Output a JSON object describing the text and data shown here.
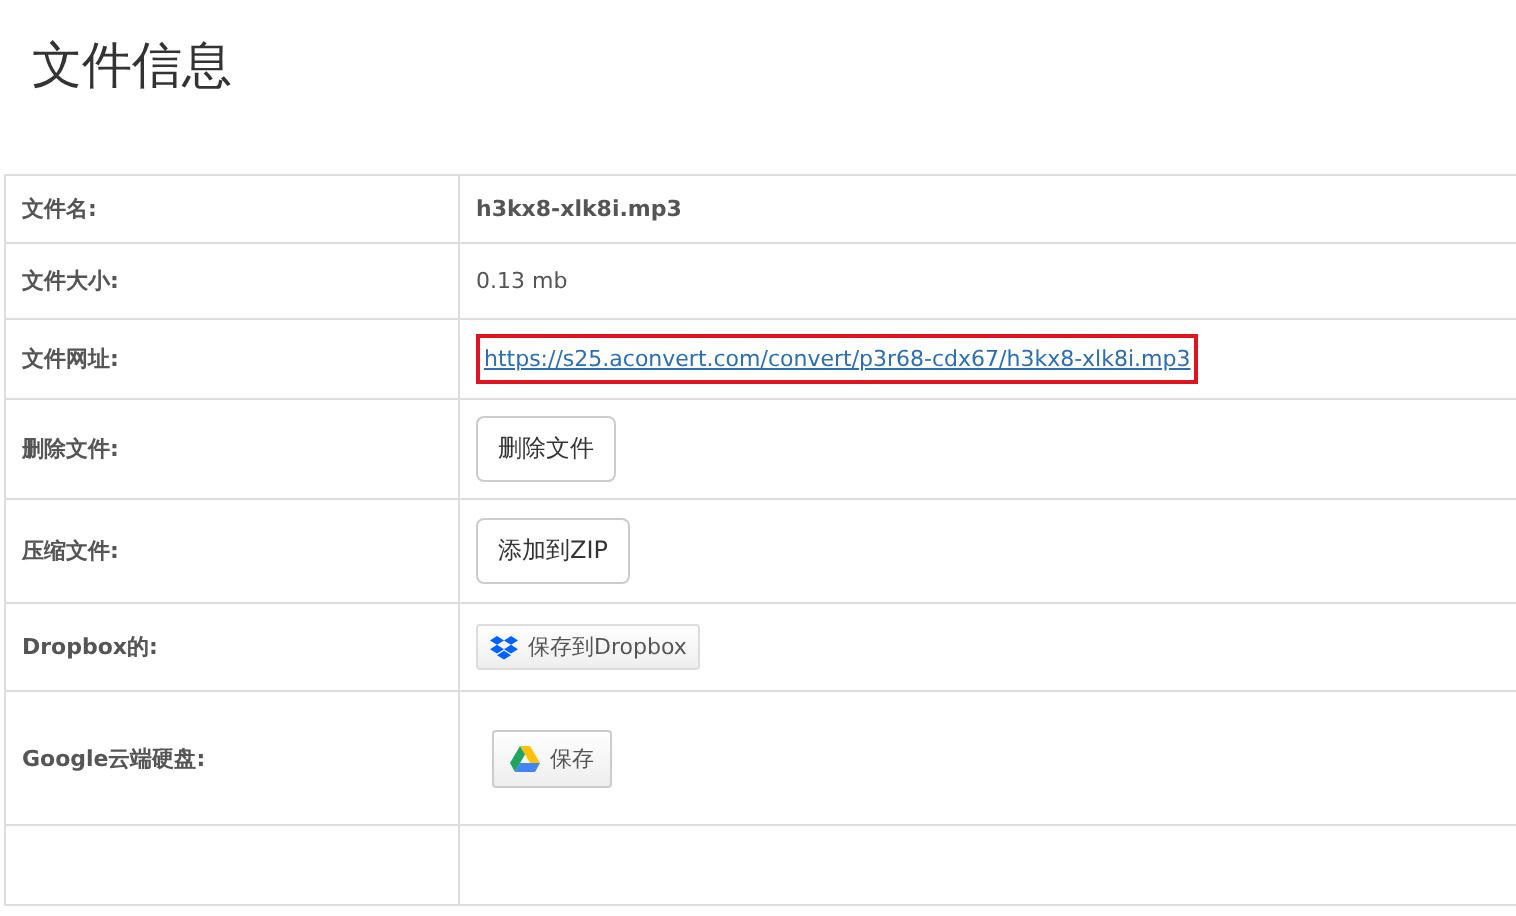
{
  "page_title": "文件信息",
  "rows": [
    {
      "label": "文件名:",
      "kind": "text",
      "value": "h3kx8-xlk8i.mp3",
      "bold": true
    },
    {
      "label": "文件大小:",
      "kind": "text",
      "value": "0.13 mb",
      "bold": false
    },
    {
      "label": "文件网址:",
      "kind": "link",
      "value": "https://s25.aconvert.com/convert/p3r68-cdx67/h3kx8-xlk8i.mp3",
      "highlighted": true
    },
    {
      "label": "删除文件:",
      "kind": "button",
      "value": "删除文件"
    },
    {
      "label": "压缩文件:",
      "kind": "button",
      "value": "添加到ZIP"
    },
    {
      "label": "Dropbox的:",
      "kind": "dropbox",
      "value": "保存到Dropbox"
    },
    {
      "label": "Google云端硬盘:",
      "kind": "drive",
      "value": "保存"
    }
  ]
}
